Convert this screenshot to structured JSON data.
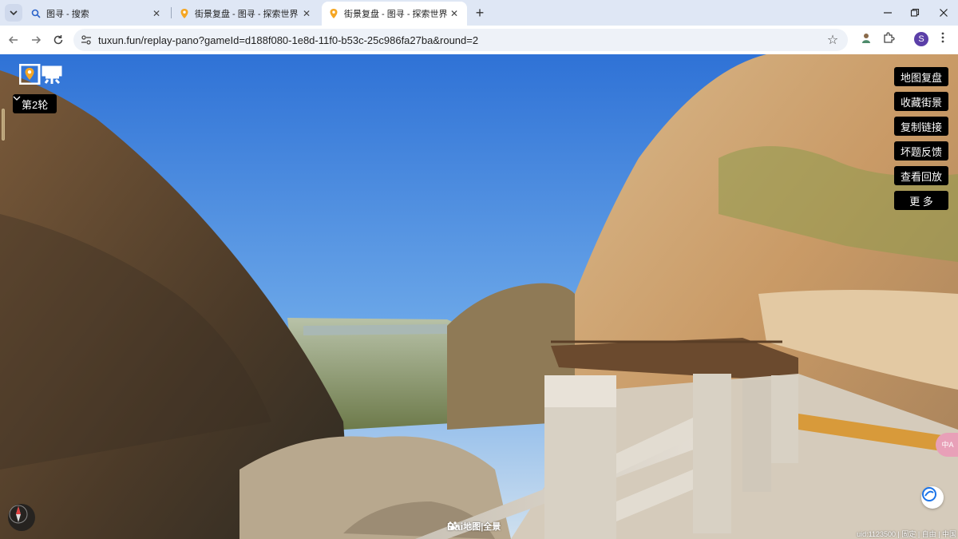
{
  "browser": {
    "tabs": [
      {
        "title": "图寻 - 搜索",
        "icon": "search-icon",
        "active": false
      },
      {
        "title": "街景复盘 - 图寻 - 探索世界",
        "icon": "location-pin-icon",
        "active": false
      },
      {
        "title": "街景复盘 - 图寻 - 探索世界",
        "icon": "location-pin-icon",
        "active": true
      }
    ],
    "new_tab": "+",
    "url": "tuxun.fun/replay-pano?gameId=d188f080-1e8d-11f0-b53c-25c986fa27ba&round=2",
    "profile_initial": "S"
  },
  "app": {
    "round_label": "第2轮",
    "side_buttons": [
      {
        "label": "地图复盘"
      },
      {
        "label": "收藏街景"
      },
      {
        "label": "复制链接"
      },
      {
        "label": "坏题反馈"
      },
      {
        "label": "查看回放"
      },
      {
        "label": "更 多"
      }
    ],
    "translate_pill": "中A",
    "baidu_brand": {
      "bai": "Bai",
      "du_rest": "地图",
      "suffix": "|全景"
    },
    "bottom_info": "uid:1123500 | 固定 | 自由 | 中国"
  },
  "colors": {
    "accent_profile": "#5b3fa8",
    "logo_orange": "#f5a623",
    "button_bg": "#000000"
  }
}
